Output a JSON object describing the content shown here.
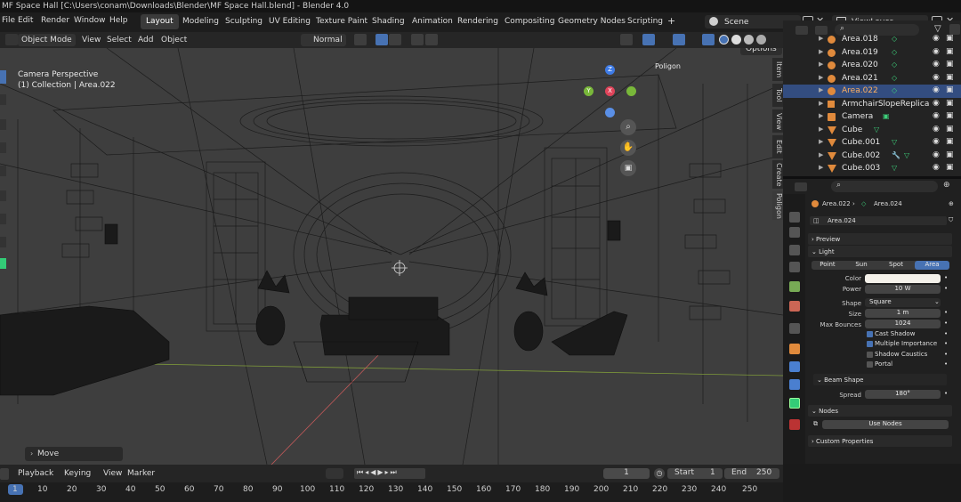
{
  "window": {
    "title": "MF Space Hall [C:\\Users\\conam\\Downloads\\Blender\\MF Space Hall.blend] - Blender 4.0"
  },
  "menubar": {
    "menus": [
      "File",
      "Edit",
      "Render",
      "Window",
      "Help"
    ],
    "workspaces": [
      "Layout",
      "Modeling",
      "Sculpting",
      "UV Editing",
      "Texture Paint",
      "Shading",
      "Animation",
      "Rendering",
      "Compositing",
      "Geometry Nodes",
      "Scripting"
    ],
    "active_workspace": "Layout",
    "add_workspace": "+",
    "scene": "Scene",
    "view_layer": "ViewLayer"
  },
  "viewport_header": {
    "mode": "Object Mode",
    "menus": [
      "View",
      "Select",
      "Add",
      "Object"
    ],
    "transform_orientation": "Normal",
    "options": "Options"
  },
  "viewport": {
    "view_name": "Camera Perspective",
    "collection_info": "(1) Collection | Area.022",
    "gizmo_axes": [
      "Z",
      "Y",
      "X"
    ],
    "operator_panel": "Move",
    "breadcrumb": "Poligon",
    "side_tabs": [
      "Item",
      "Tool",
      "View",
      "Edit",
      "Create",
      "Poligon"
    ]
  },
  "outliner": {
    "items": [
      {
        "name": "Area.018",
        "type": "light"
      },
      {
        "name": "Area.019",
        "type": "light"
      },
      {
        "name": "Area.020",
        "type": "light"
      },
      {
        "name": "Area.021",
        "type": "light"
      },
      {
        "name": "Area.022",
        "type": "light",
        "selected": true
      },
      {
        "name": "ArmchairSlopeReplica",
        "type": "empty"
      },
      {
        "name": "Camera",
        "type": "camera"
      },
      {
        "name": "Cube",
        "type": "mesh"
      },
      {
        "name": "Cube.001",
        "type": "mesh"
      },
      {
        "name": "Cube.002",
        "type": "mesh"
      },
      {
        "name": "Cube.003",
        "type": "mesh"
      }
    ]
  },
  "properties": {
    "breadcrumb_object": "Area.022",
    "breadcrumb_data": "Area.024",
    "data_name": "Area.024",
    "sections": {
      "preview": "Preview",
      "light": "Light",
      "beam_shape": "Beam Shape",
      "nodes": "Nodes",
      "custom_properties": "Custom Properties"
    },
    "light_types": [
      "Point",
      "Sun",
      "Spot",
      "Area"
    ],
    "active_light_type": "Area",
    "fields": {
      "color_label": "Color",
      "power_label": "Power",
      "power_value": "10 W",
      "shape_label": "Shape",
      "shape_value": "Square",
      "size_label": "Size",
      "size_value": "1 m",
      "max_bounces_label": "Max Bounces",
      "max_bounces_value": "1024",
      "spread_label": "Spread",
      "spread_value": "180°"
    },
    "checkboxes": [
      {
        "label": "Cast Shadow",
        "checked": true
      },
      {
        "label": "Multiple Importance",
        "checked": true
      },
      {
        "label": "Shadow Caustics",
        "checked": false
      },
      {
        "label": "Portal",
        "checked": false
      }
    ],
    "use_nodes": "Use Nodes"
  },
  "timeline": {
    "menus": [
      "Playback",
      "Keying",
      "View",
      "Marker"
    ],
    "current_frame": "1",
    "start_label": "Start",
    "start_value": "1",
    "end_label": "End",
    "end_value": "250",
    "ruler": [
      "1",
      "10",
      "20",
      "30",
      "40",
      "50",
      "60",
      "70",
      "80",
      "90",
      "100",
      "110",
      "120",
      "130",
      "140",
      "150",
      "160",
      "170",
      "180",
      "190",
      "200",
      "210",
      "220",
      "230",
      "240",
      "250"
    ]
  },
  "colors": {
    "accent": "#4772b3",
    "light_icon": "#e08a3c",
    "modifier": "#3dcf7a",
    "viewport_bg": "#3d3d3d"
  }
}
